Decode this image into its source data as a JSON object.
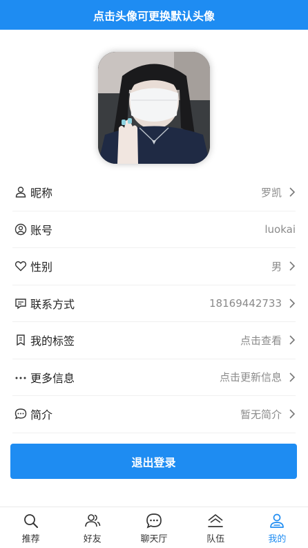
{
  "header": {
    "banner_text": "点击头像可更换默认头像"
  },
  "profile": {
    "avatar_alt": "avatar-photo",
    "rows": [
      {
        "label": "昵称",
        "value": "罗凯",
        "icon": "user-icon",
        "chevron": true
      },
      {
        "label": "账号",
        "value": "luokai",
        "icon": "account-circle-icon",
        "chevron": false
      },
      {
        "label": "性别",
        "value": "男",
        "icon": "heart-icon",
        "chevron": true
      },
      {
        "label": "联系方式",
        "value": "18169442733",
        "icon": "message-icon",
        "chevron": true
      },
      {
        "label": "我的标签",
        "value": "点击查看",
        "icon": "bookmark-icon",
        "chevron": true
      },
      {
        "label": "更多信息",
        "value": "点击更新信息",
        "icon": "more-dots-icon",
        "chevron": true
      },
      {
        "label": "简介",
        "value": "暂无简介",
        "icon": "chat-bubble-icon",
        "chevron": true
      }
    ]
  },
  "actions": {
    "logout_label": "退出登录"
  },
  "tabbar": {
    "items": [
      {
        "label": "推荐",
        "icon": "search-icon",
        "active": false
      },
      {
        "label": "好友",
        "icon": "friends-icon",
        "active": false
      },
      {
        "label": "聊天厅",
        "icon": "chat-hall-icon",
        "active": false
      },
      {
        "label": "队伍",
        "icon": "team-icon",
        "active": false
      },
      {
        "label": "我的",
        "icon": "profile-icon",
        "active": true
      }
    ]
  },
  "colors": {
    "accent": "#1e8cf2",
    "muted_text": "#8a8a8a"
  }
}
